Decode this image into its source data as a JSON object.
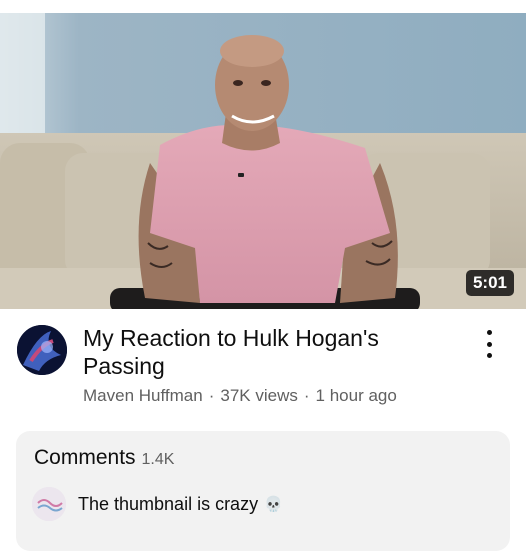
{
  "video": {
    "duration": "5:01",
    "title": "My Reaction to Hulk Hogan's Passing",
    "channel": "Maven Huffman",
    "views": "37K views",
    "age": "1 hour ago",
    "separator": "·"
  },
  "comments": {
    "heading": "Comments",
    "count": "1.4K",
    "top_comment": {
      "text": "The thumbnail is crazy",
      "emoji": "💀"
    }
  },
  "icons": {
    "more": "more-vert-icon",
    "skull": "skull-icon"
  },
  "colors": {
    "duration_bg": "#000000",
    "secondary_text": "#606060",
    "comments_bg": "#f2f2f2"
  }
}
